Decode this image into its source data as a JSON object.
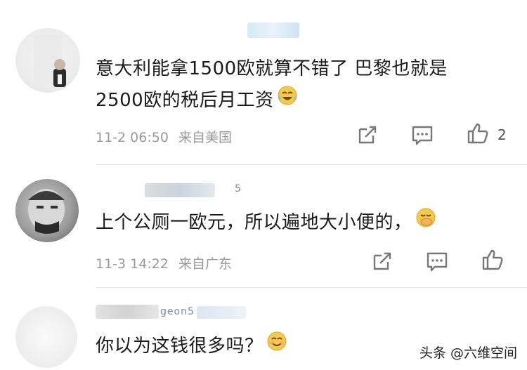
{
  "comments": [
    {
      "text_line1": "意大利能拿1500欧就算不错了 巴黎也就是",
      "text_line2": "2500欧的税后月工资",
      "emoji": "crying-laughing-face",
      "time": "11-2 06:50",
      "location": "来自美国",
      "likes": "2"
    },
    {
      "username_fragment": "5",
      "text": "上个公厕一欧元，所以遍地大小便的，",
      "emoji": "hand-over-mouth-face",
      "time": "11-3 14:22",
      "location": "来自广东"
    },
    {
      "username_fragment": "geon5",
      "text": "你以为这钱很多吗？",
      "emoji": "smiling-face"
    }
  ],
  "watermark": "头条 @六维空间",
  "icons": {
    "share": "share-icon",
    "reply": "reply-icon",
    "like": "thumbs-up-icon"
  },
  "colors": {
    "text": "#1a1a1a",
    "meta": "#9a9a9a",
    "username": "#7a8aa6",
    "background": "#ffffff"
  }
}
